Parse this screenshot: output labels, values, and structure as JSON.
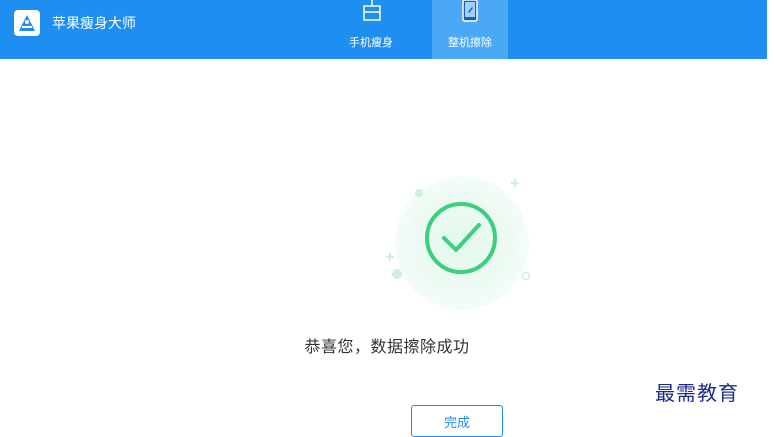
{
  "app": {
    "title": "苹果瘦身大师"
  },
  "tabs": [
    {
      "label": "手机瘦身",
      "icon": "phone-slim-icon",
      "active": false
    },
    {
      "label": "整机擦除",
      "icon": "phone-wipe-icon",
      "active": true
    }
  ],
  "main": {
    "success_message": "恭喜您，数据擦除成功",
    "done_button": "完成",
    "status_icon": "check-circle-icon"
  },
  "watermark": "最需教育",
  "colors": {
    "topbar": "#1f8ef1",
    "active_tab": "#4ba8f5",
    "success_green": "#3ccf7e",
    "button_accent": "#1f8ef1"
  }
}
